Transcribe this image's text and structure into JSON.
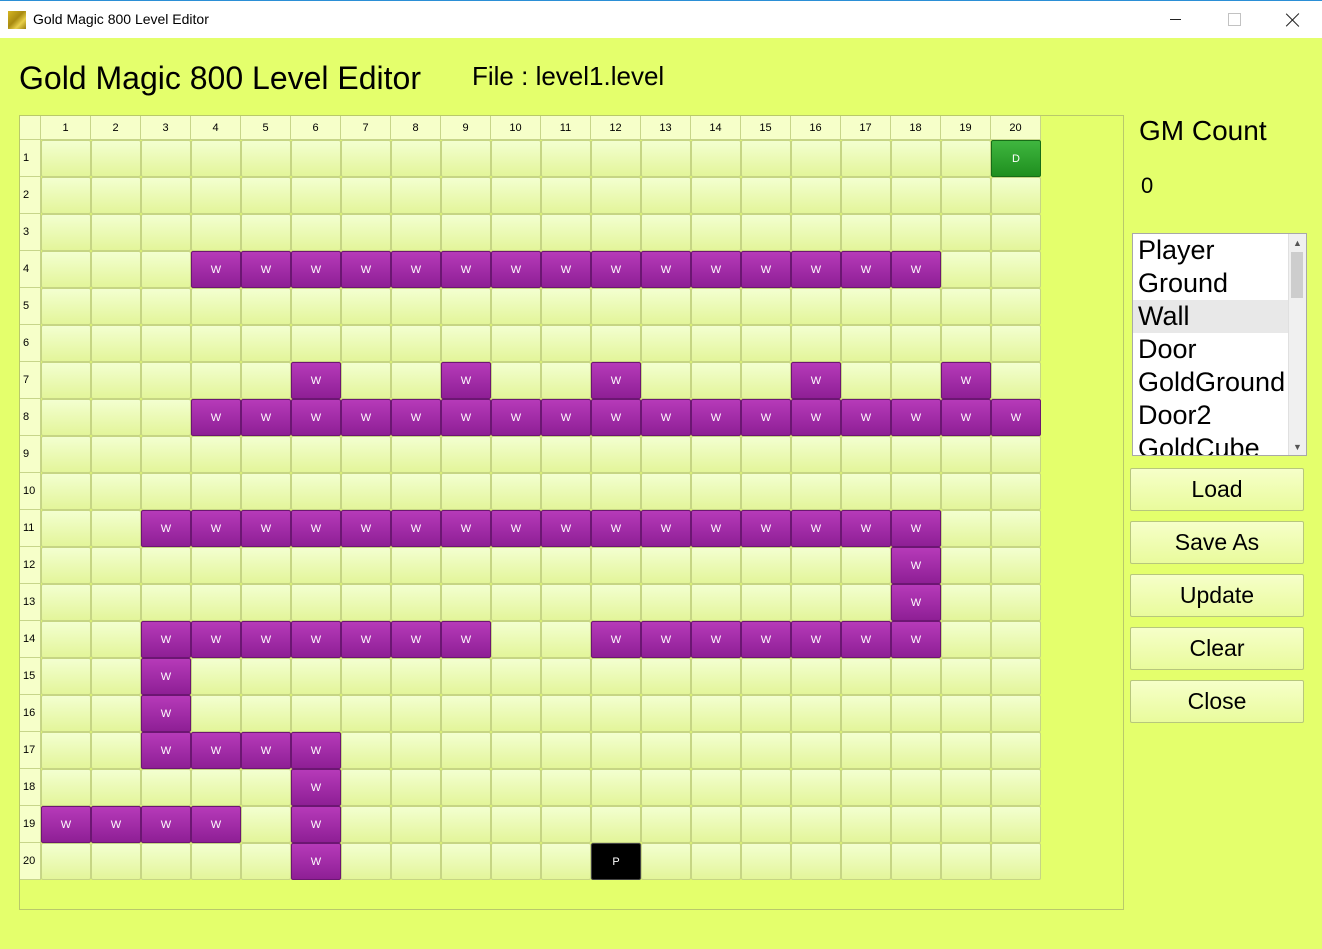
{
  "window": {
    "title": "Gold Magic 800 Level Editor",
    "minimize_symbol": "—",
    "close_symbol": "×"
  },
  "header": {
    "title": "Gold Magic 800 Level Editor",
    "file_label": "File : level1.level"
  },
  "grid": {
    "columns": [
      "1",
      "2",
      "3",
      "4",
      "5",
      "6",
      "7",
      "8",
      "9",
      "10",
      "11",
      "12",
      "13",
      "14",
      "15",
      "16",
      "17",
      "18",
      "19",
      "20"
    ],
    "rows": [
      "1",
      "2",
      "3",
      "4",
      "5",
      "6",
      "7",
      "8",
      "9",
      "10",
      "11",
      "12",
      "13",
      "14",
      "15",
      "16",
      "17",
      "18",
      "19",
      "20"
    ],
    "cells": [
      [
        "",
        "",
        "",
        "",
        "",
        "",
        "",
        "",
        "",
        "",
        "",
        "",
        "",
        "",
        "",
        "",
        "",
        "",
        "",
        "D"
      ],
      [
        "",
        "",
        "",
        "",
        "",
        "",
        "",
        "",
        "",
        "",
        "",
        "",
        "",
        "",
        "",
        "",
        "",
        "",
        "",
        ""
      ],
      [
        "",
        "",
        "",
        "",
        "",
        "",
        "",
        "",
        "",
        "",
        "",
        "",
        "",
        "",
        "",
        "",
        "",
        "",
        "",
        ""
      ],
      [
        "",
        "",
        "",
        "W",
        "W",
        "W",
        "W",
        "W",
        "W",
        "W",
        "W",
        "W",
        "W",
        "W",
        "W",
        "W",
        "W",
        "W",
        "",
        ""
      ],
      [
        "",
        "",
        "",
        "",
        "",
        "",
        "",
        "",
        "",
        "",
        "",
        "",
        "",
        "",
        "",
        "",
        "",
        "",
        "",
        ""
      ],
      [
        "",
        "",
        "",
        "",
        "",
        "",
        "",
        "",
        "",
        "",
        "",
        "",
        "",
        "",
        "",
        "",
        "",
        "",
        "",
        ""
      ],
      [
        "",
        "",
        "",
        "",
        "",
        "W",
        "",
        "",
        "W",
        "",
        "",
        "W",
        "",
        "",
        "",
        "W",
        "",
        "",
        "W",
        ""
      ],
      [
        "",
        "",
        "",
        "W",
        "W",
        "W",
        "W",
        "W",
        "W",
        "W",
        "W",
        "W",
        "W",
        "W",
        "W",
        "W",
        "W",
        "W",
        "W",
        "W"
      ],
      [
        "",
        "",
        "",
        "",
        "",
        "",
        "",
        "",
        "",
        "",
        "",
        "",
        "",
        "",
        "",
        "",
        "",
        "",
        "",
        ""
      ],
      [
        "",
        "",
        "",
        "",
        "",
        "",
        "",
        "",
        "",
        "",
        "",
        "",
        "",
        "",
        "",
        "",
        "",
        "",
        "",
        ""
      ],
      [
        "",
        "",
        "W",
        "W",
        "W",
        "W",
        "W",
        "W",
        "W",
        "W",
        "W",
        "W",
        "W",
        "W",
        "W",
        "W",
        "W",
        "W",
        "",
        ""
      ],
      [
        "",
        "",
        "",
        "",
        "",
        "",
        "",
        "",
        "",
        "",
        "",
        "",
        "",
        "",
        "",
        "",
        "",
        "W",
        "",
        ""
      ],
      [
        "",
        "",
        "",
        "",
        "",
        "",
        "",
        "",
        "",
        "",
        "",
        "",
        "",
        "",
        "",
        "",
        "",
        "W",
        "",
        ""
      ],
      [
        "",
        "",
        "W",
        "W",
        "W",
        "W",
        "W",
        "W",
        "W",
        "",
        "",
        "W",
        "W",
        "W",
        "W",
        "W",
        "W",
        "W",
        "",
        ""
      ],
      [
        "",
        "",
        "W",
        "",
        "",
        "",
        "",
        "",
        "",
        "",
        "",
        "",
        "",
        "",
        "",
        "",
        "",
        "",
        "",
        ""
      ],
      [
        "",
        "",
        "W",
        "",
        "",
        "",
        "",
        "",
        "",
        "",
        "",
        "",
        "",
        "",
        "",
        "",
        "",
        "",
        "",
        ""
      ],
      [
        "",
        "",
        "W",
        "W",
        "W",
        "W",
        "",
        "",
        "",
        "",
        "",
        "",
        "",
        "",
        "",
        "",
        "",
        "",
        "",
        ""
      ],
      [
        "",
        "",
        "",
        "",
        "",
        "W",
        "",
        "",
        "",
        "",
        "",
        "",
        "",
        "",
        "",
        "",
        "",
        "",
        "",
        ""
      ],
      [
        "W",
        "W",
        "W",
        "W",
        "",
        "W",
        "",
        "",
        "",
        "",
        "",
        "",
        "",
        "",
        "",
        "",
        "",
        "",
        "",
        ""
      ],
      [
        "",
        "",
        "",
        "",
        "",
        "W",
        "",
        "",
        "",
        "",
        "",
        "P",
        "",
        "",
        "",
        "",
        "",
        "",
        "",
        ""
      ]
    ],
    "cell_colors": {
      "W": "#a22da8",
      "D": "#2e9f2e",
      "P": "#000000",
      "empty": "#eefcb8"
    }
  },
  "gm_count": {
    "label": "GM Count",
    "value": "0"
  },
  "tile_list": {
    "items": [
      "Player",
      "Ground",
      "Wall",
      "Door",
      "GoldGround",
      "Door2",
      "GoldCube"
    ],
    "selected": "Wall"
  },
  "buttons": {
    "load": "Load",
    "save_as": "Save As",
    "update": "Update",
    "clear": "Clear",
    "close": "Close"
  },
  "colors": {
    "background": "#e4ff6c",
    "wall": "#a22da8",
    "door": "#2e9f2e",
    "player": "#000000"
  }
}
